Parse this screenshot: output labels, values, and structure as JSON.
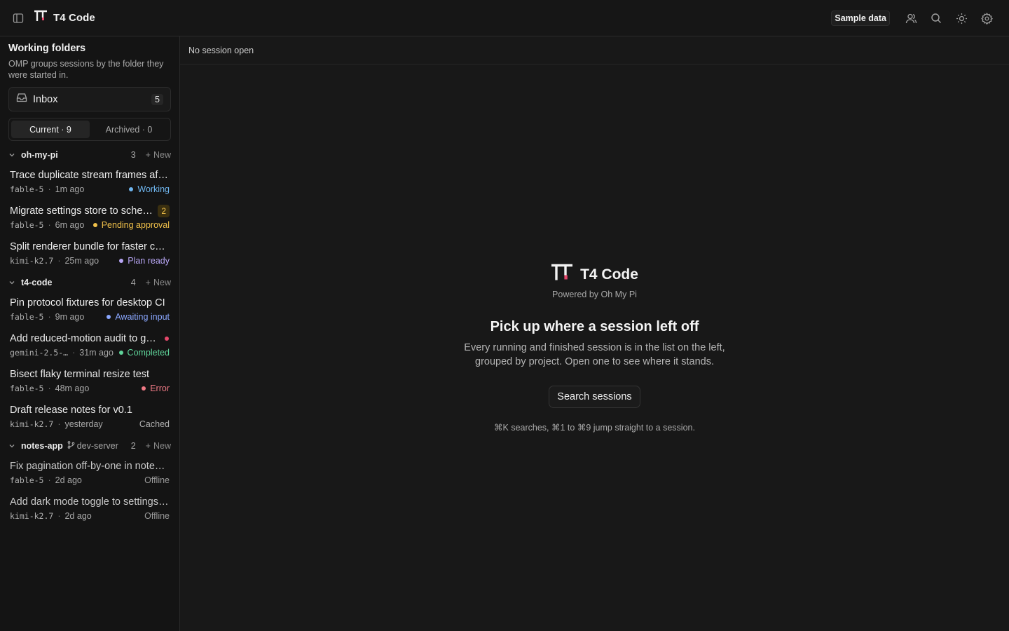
{
  "app": {
    "title": "T4 Code"
  },
  "topbar": {
    "sample_data_label": "Sample data",
    "icons": [
      "sidebar-toggle-icon",
      "users-icon",
      "search-icon",
      "sun-icon",
      "gear-icon"
    ]
  },
  "sidebar": {
    "title": "Working folders",
    "description": "OMP groups sessions by the folder they were started in.",
    "inbox": {
      "label": "Inbox",
      "count": "5"
    },
    "tabs": {
      "current": "Current · 9",
      "archived": "Archived · 0"
    },
    "groups": [
      {
        "name": "oh-my-pi",
        "count": "3",
        "new_label": "New",
        "branch": ""
      },
      {
        "name": "t4-code",
        "count": "4",
        "new_label": "New",
        "branch": ""
      },
      {
        "name": "notes-app",
        "count": "2",
        "new_label": "New",
        "branch": "dev-server"
      }
    ],
    "sessions": [
      {
        "title": "Trace duplicate stream frames aft…",
        "model": "fable-5",
        "time": "1m ago",
        "status": "Working",
        "status_color": "#6fb6ef",
        "badge": ""
      },
      {
        "title": "Migrate settings store to sche…",
        "model": "fable-5",
        "time": "6m ago",
        "status": "Pending approval",
        "status_color": "#f0c04a",
        "badge": "2"
      },
      {
        "title": "Split renderer bundle for faster co…",
        "model": "kimi-k2.7",
        "time": "25m ago",
        "status": "Plan ready",
        "status_color": "#b8a6f5",
        "badge": ""
      },
      {
        "title": "Pin protocol fixtures for desktop CI",
        "model": "fable-5",
        "time": "9m ago",
        "status": "Awaiting input",
        "status_color": "#8aa7ff",
        "badge": ""
      },
      {
        "title": "Add reduced-motion audit to g…",
        "model": "gemini-2.5-…",
        "time": "31m ago",
        "status": "Completed",
        "status_color": "#5fd49a",
        "badge": ""
      },
      {
        "title": "Bisect flaky terminal resize test",
        "model": "fable-5",
        "time": "48m ago",
        "status": "Error",
        "status_color": "#f07a86",
        "badge": ""
      },
      {
        "title": "Draft release notes for v0.1",
        "model": "kimi-k2.7",
        "time": "yesterday",
        "status": "Cached",
        "status_color": "#b0b0b0",
        "badge": ""
      },
      {
        "title": "Fix pagination off-by-one in note…",
        "model": "fable-5",
        "time": "2d ago",
        "status": "Offline",
        "status_color": "#9a9a9a",
        "badge": ""
      },
      {
        "title": "Add dark mode toggle to settings…",
        "model": "kimi-k2.7",
        "time": "2d ago",
        "status": "Offline",
        "status_color": "#9a9a9a",
        "badge": ""
      }
    ]
  },
  "main": {
    "header": "No session open",
    "brand_title": "T4 Code",
    "powered_by": "Powered by Oh My Pi",
    "heading": "Pick up where a session left off",
    "description": "Every running and finished session is in the list on the left, grouped by project. Open one to see where it stands.",
    "search_button": "Search sessions",
    "hint": "⌘K searches, ⌘1 to ⌘9 jump straight to a session."
  },
  "colors": {
    "accent_logo": "#e5486b",
    "background": "#181818",
    "sidebar": "#141414"
  }
}
